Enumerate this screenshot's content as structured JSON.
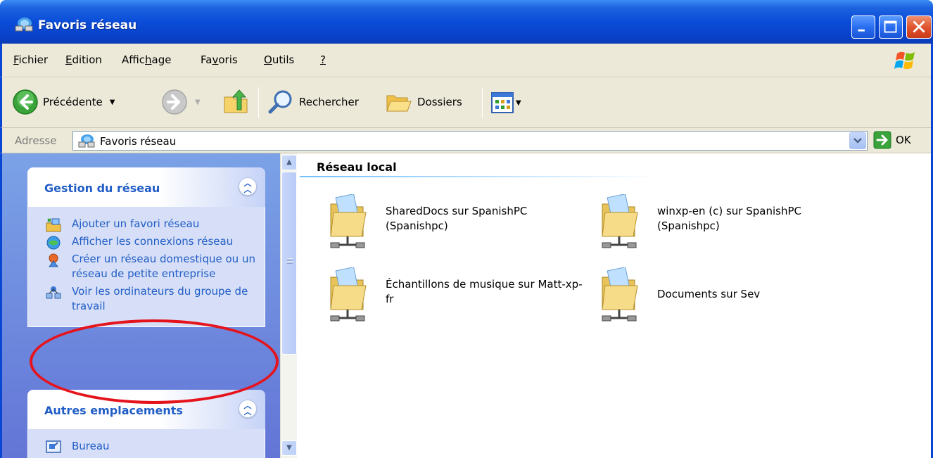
{
  "window": {
    "title": "Favoris réseau",
    "icon": "network-places-icon",
    "controls": [
      "minimize",
      "maximize",
      "close"
    ]
  },
  "menubar": {
    "items": [
      {
        "label": "Fichier",
        "accel": "F"
      },
      {
        "label": "Edition",
        "accel": "E"
      },
      {
        "label": "Affichage",
        "accel": "h"
      },
      {
        "label": "Favoris",
        "accel": "v"
      },
      {
        "label": "Outils",
        "accel": "O"
      },
      {
        "label": "?",
        "accel": "?"
      }
    ]
  },
  "toolbar": {
    "back_label": "Précédente",
    "search_label": "Rechercher",
    "folders_label": "Dossiers"
  },
  "address": {
    "label": "Adresse",
    "value": "Favoris réseau",
    "go_label": "OK"
  },
  "tasks": {
    "network": {
      "title": "Gestion du réseau",
      "items": [
        {
          "label": "Ajouter un favori réseau",
          "icon": "add-network-place-icon"
        },
        {
          "label": "Afficher les connexions réseau",
          "icon": "network-connections-icon"
        },
        {
          "label": "Créer un réseau domestique ou un réseau de petite entreprise",
          "icon": "home-network-icon"
        },
        {
          "label": "Voir les ordinateurs du groupe de travail",
          "icon": "workgroup-computers-icon"
        }
      ]
    },
    "other": {
      "title": "Autres emplacements",
      "items": [
        {
          "label": "Bureau",
          "icon": "desktop-icon"
        }
      ]
    }
  },
  "content": {
    "group_title": "Réseau local",
    "items": [
      {
        "label": "SharedDocs sur SpanishPC (Spanishpc)",
        "icon": "network-share-folder-icon"
      },
      {
        "label": "winxp-en (c) sur SpanishPC (Spanishpc)",
        "icon": "network-share-folder-icon"
      },
      {
        "label": "Échantillons de musique sur Matt-xp-fr",
        "icon": "network-share-folder-icon"
      },
      {
        "label": "Documents sur Sev",
        "icon": "network-share-folder-icon"
      }
    ]
  },
  "colors": {
    "titlebar": "#0a4cd8",
    "chrome": "#ece9d8",
    "taskpane": "#7ba2e7",
    "task_link": "#215dc6",
    "annotation": "#e5141c"
  }
}
